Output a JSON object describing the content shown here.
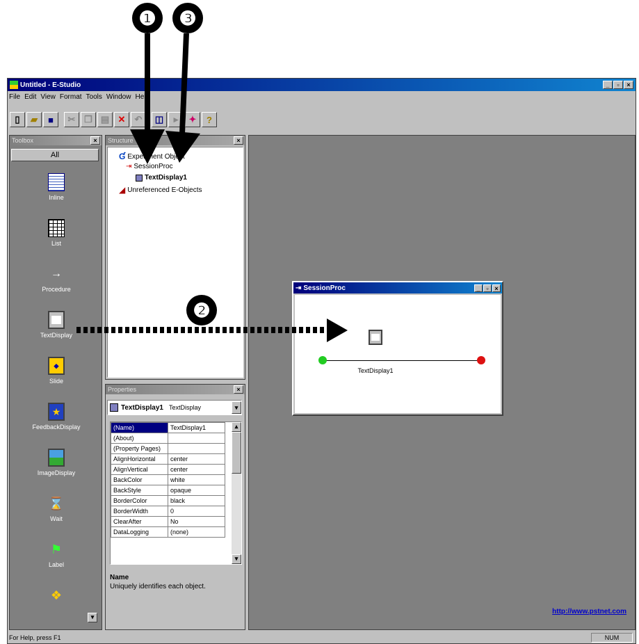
{
  "callouts": {
    "one": "❶",
    "two": "❷",
    "three": "❸"
  },
  "window": {
    "title": "Untitled - E-Studio"
  },
  "menu": [
    "File",
    "Edit",
    "View",
    "Format",
    "Tools",
    "Window",
    "Help"
  ],
  "toolbar_icons": [
    "new-file-icon",
    "open-folder-icon",
    "save-icon",
    "cut-icon",
    "copy-icon",
    "paste-icon",
    "delete-icon",
    "undo-icon",
    "properties-icon",
    "run-icon",
    "debug-icon",
    "help-icon"
  ],
  "toolbox": {
    "header": "Toolbox",
    "all_button": "All",
    "items": [
      {
        "label": "Inline",
        "icon": "inline-icon"
      },
      {
        "label": "List",
        "icon": "list-icon"
      },
      {
        "label": "Procedure",
        "icon": "procedure-icon"
      },
      {
        "label": "TextDisplay",
        "icon": "text-display-icon"
      },
      {
        "label": "Slide",
        "icon": "slide-icon"
      },
      {
        "label": "FeedbackDisplay",
        "icon": "feedback-display-icon"
      },
      {
        "label": "ImageDisplay",
        "icon": "image-display-icon"
      },
      {
        "label": "Wait",
        "icon": "wait-icon"
      },
      {
        "label": "Label",
        "icon": "label-icon"
      }
    ]
  },
  "structure": {
    "header": "Structure",
    "tree": [
      "Experiment Object",
      "SessionProc",
      "TextDisplay1",
      "Unreferenced E-Objects"
    ]
  },
  "properties": {
    "header": "Properties",
    "object_name": "TextDisplay1",
    "object_type": "TextDisplay",
    "rows": [
      {
        "k": "(Name)",
        "v": "TextDisplay1"
      },
      {
        "k": "(About)",
        "v": ""
      },
      {
        "k": "(Property Pages)",
        "v": ""
      },
      {
        "k": "AlignHorizontal",
        "v": "center"
      },
      {
        "k": "AlignVertical",
        "v": "center"
      },
      {
        "k": "BackColor",
        "v": "white"
      },
      {
        "k": "BackStyle",
        "v": "opaque"
      },
      {
        "k": "BorderColor",
        "v": "black"
      },
      {
        "k": "BorderWidth",
        "v": "0"
      },
      {
        "k": "ClearAfter",
        "v": "No"
      },
      {
        "k": "DataLogging",
        "v": "(none)"
      }
    ],
    "desc_title": "Name",
    "desc_text": "Uniquely identifies each object."
  },
  "session_window": {
    "title": "SessionProc",
    "object_label": "TextDisplay1"
  },
  "url": "http://www.pstnet.com",
  "status": {
    "text": "For Help, press F1",
    "num": "NUM"
  },
  "colors": {
    "titlebar": "#00007a",
    "workspace": "#808080",
    "toolbox_bg": "#808080",
    "start_dot": "#22cc22",
    "end_dot": "#dd1111"
  }
}
